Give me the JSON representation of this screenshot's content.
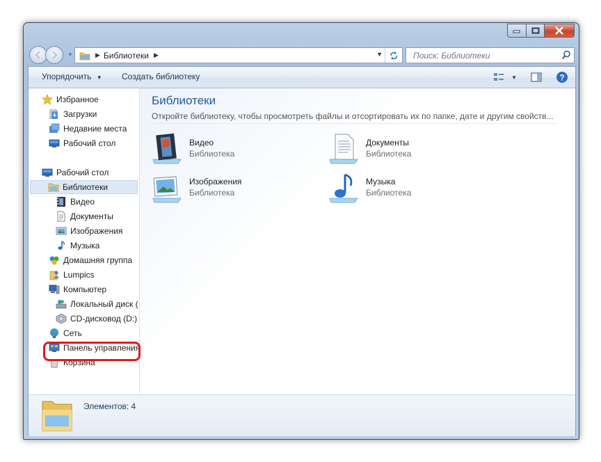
{
  "window": {
    "colors": {
      "accent": "#1e5b9b",
      "close_button": "#c9462c",
      "highlight": "#e01b1b"
    }
  },
  "navigation": {
    "address_crumb": "Библиотеки",
    "search_placeholder": "Поиск: Библиотеки"
  },
  "toolbar": {
    "organize_label": "Упорядочить",
    "new_library_label": "Создать библиотеку"
  },
  "sidebar": {
    "favorites": {
      "label": "Избранное",
      "icon": "star-icon"
    },
    "favorites_items": [
      {
        "label": "Загрузки",
        "icon": "downloads-icon"
      },
      {
        "label": "Недавние места",
        "icon": "recent-places-icon"
      },
      {
        "label": "Рабочий стол",
        "icon": "desktop-icon"
      }
    ],
    "desktop": {
      "label": "Рабочий стол",
      "icon": "desktop-icon"
    },
    "libraries": {
      "label": "Библиотеки",
      "icon": "libraries-folder-icon"
    },
    "library_items": [
      {
        "label": "Видео",
        "icon": "video-icon"
      },
      {
        "label": "Документы",
        "icon": "documents-icon"
      },
      {
        "label": "Изображения",
        "icon": "pictures-icon"
      },
      {
        "label": "Музыка",
        "icon": "music-icon"
      }
    ],
    "homegroup": {
      "label": "Домашняя группа",
      "icon": "homegroup-icon"
    },
    "user": {
      "label": "Lumpics",
      "icon": "user-folder-icon"
    },
    "computer": {
      "label": "Компьютер",
      "icon": "computer-icon"
    },
    "computer_items": [
      {
        "label": "Локальный диск (",
        "icon": "local-disk-icon"
      },
      {
        "label": "CD-дисковод (D:)",
        "icon": "cd-drive-icon"
      }
    ],
    "network": {
      "label": "Сеть",
      "icon": "network-icon"
    },
    "control_panel": {
      "label": "Панель управления",
      "icon": "control-panel-icon"
    },
    "recycle_bin": {
      "label": "Корзина",
      "icon": "recycle-bin-icon"
    }
  },
  "content": {
    "title": "Библиотеки",
    "description": "Откройте библиотеку, чтобы просмотреть файлы и отсортировать их по папке, дате и другим свойств...",
    "libraries": [
      {
        "name": "Видео",
        "type": "Библиотека",
        "icon": "video-library-icon"
      },
      {
        "name": "Документы",
        "type": "Библиотека",
        "icon": "documents-library-icon"
      },
      {
        "name": "Изображения",
        "type": "Библиотека",
        "icon": "pictures-library-icon"
      },
      {
        "name": "Музыка",
        "type": "Библиотека",
        "icon": "music-library-icon"
      }
    ]
  },
  "status": {
    "items_count": "Элементов: 4"
  }
}
